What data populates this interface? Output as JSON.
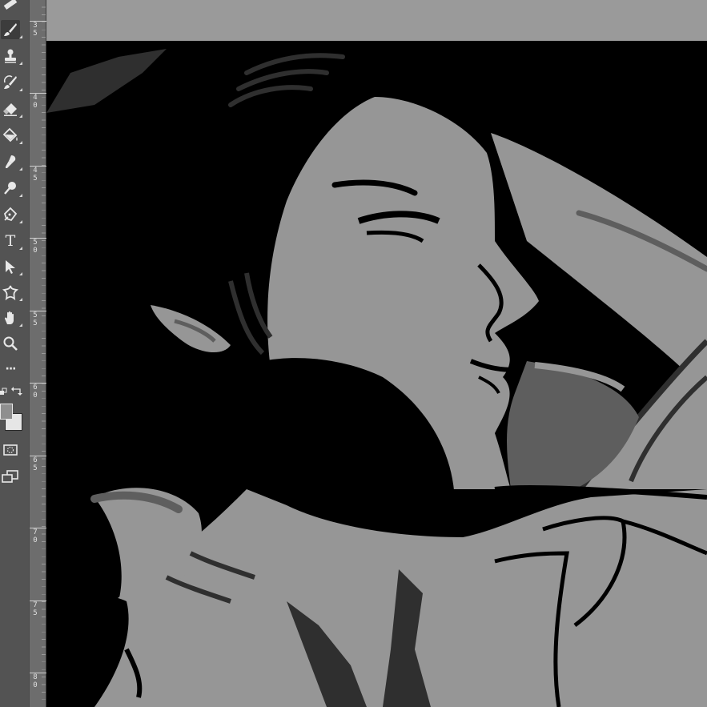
{
  "app": {
    "name": "image editor"
  },
  "colors": {
    "toolbar_bg": "#535353",
    "ruler_bg": "#6d6d6d",
    "pasteboard": "#9a9a9a",
    "canvas_black": "#000000",
    "skin_gray": "#969696",
    "mid_gray": "#5e5e5e",
    "dark_gray": "#2f2f2f",
    "foreground_swatch": "#8f8f8f",
    "background_swatch": "#e6e6e6"
  },
  "toolbar": {
    "tools": [
      {
        "icon": "ruler-icon"
      },
      {
        "icon": "brush-icon"
      },
      {
        "icon": "clone-stamp-icon"
      },
      {
        "icon": "history-brush-icon"
      },
      {
        "icon": "eraser-icon"
      },
      {
        "icon": "paint-bucket-icon"
      },
      {
        "icon": "smudge-icon"
      },
      {
        "icon": "dodge-icon"
      },
      {
        "icon": "pen-icon"
      },
      {
        "icon": "type-icon",
        "glyph": "T"
      },
      {
        "icon": "path-selection-icon"
      },
      {
        "icon": "custom-shape-icon"
      },
      {
        "icon": "hand-icon"
      },
      {
        "icon": "zoom-icon"
      },
      {
        "icon": "more-tools-icon",
        "glyph": "···"
      }
    ]
  },
  "ruler": {
    "labels": [
      "3\n5",
      "4\n0",
      "4\n5",
      "5\n0",
      "5\n5",
      "6\n0",
      "6\n5",
      "7\n0",
      "7\n5",
      "8\n0"
    ]
  }
}
